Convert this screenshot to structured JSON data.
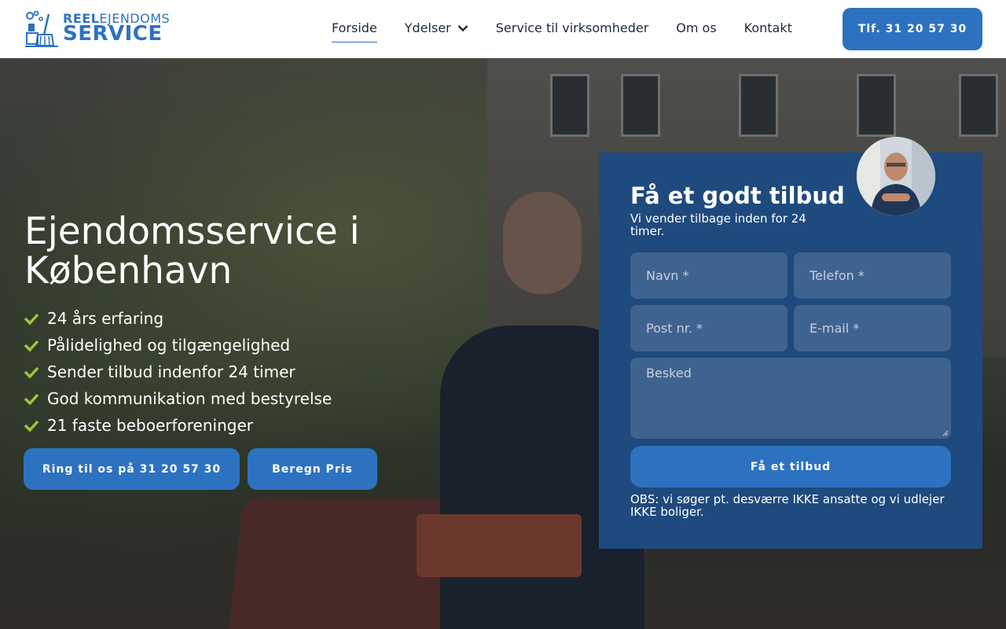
{
  "brand": {
    "logo_top_bold": "R",
    "logo_top_mid": "EEL",
    "logo_top_rest": "EJENDOMS",
    "logo_bottom": "SERVICE",
    "accent": "#2d72c0",
    "form_bg": "#1e4a7e",
    "check_color": "#9cc63b"
  },
  "nav": {
    "items": [
      {
        "label": "Forside",
        "active": true
      },
      {
        "label": "Ydelser",
        "dropdown": true
      },
      {
        "label": "Service til virksomheder"
      },
      {
        "label": "Om os"
      },
      {
        "label": "Kontakt"
      }
    ],
    "phone_button": "Tlf. 31 20 57 30"
  },
  "hero": {
    "title": "Ejendomsservice i København",
    "features": [
      "24 års erfaring",
      "Pålidelighed og tilgængelighed",
      "Sender tilbud indenfor 24 timer",
      "God kommunikation med bestyrelse",
      "21 faste beboerforeninger"
    ],
    "call_button": "Ring til os på 31 20 57 30",
    "price_button": "Beregn Pris"
  },
  "form": {
    "title": "Få et godt tilbud",
    "subtitle": "Vi vender tilbage inden for 24 timer.",
    "fields": {
      "name": "Navn *",
      "phone": "Telefon *",
      "zip": "Post nr. *",
      "email": "E-mail *",
      "message": "Besked"
    },
    "submit": "Få et tilbud",
    "note": "OBS: vi søger pt. desværre IKKE ansatte og vi udlejer IKKE boliger."
  }
}
